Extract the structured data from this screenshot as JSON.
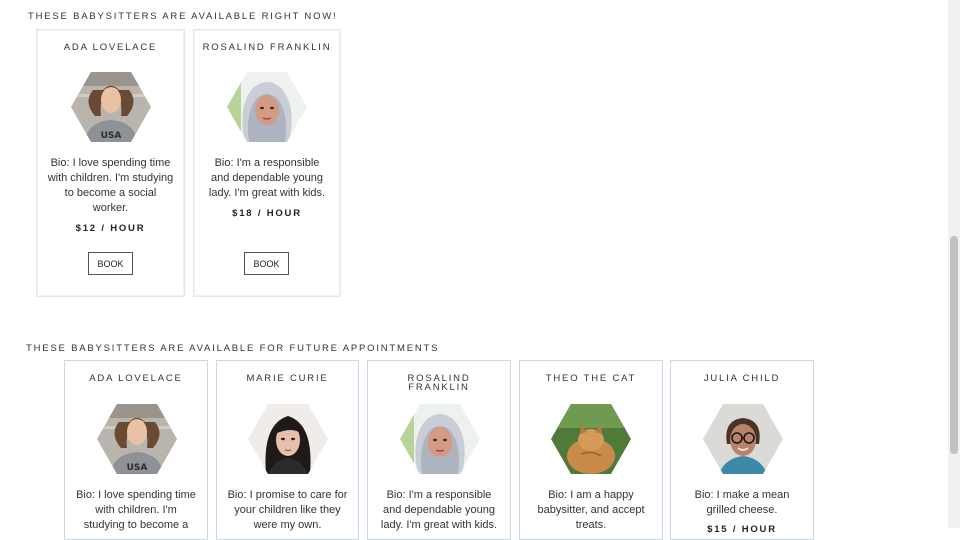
{
  "sections": {
    "now_title": "THESE BABYSITTERS ARE AVAILABLE RIGHT NOW!",
    "future_title": "THESE BABYSITTERS ARE AVAILABLE FOR FUTURE APPOINTMENTS"
  },
  "available_now": [
    {
      "name": "ADA LOVELACE",
      "bio": "Bio: I love spending time with children. I'm studying to become a social worker.",
      "rate": "$12 / HOUR",
      "button": "BOOK"
    },
    {
      "name": "ROSALIND FRANKLIN",
      "bio": "Bio: I'm a responsible and dependable young lady. I'm great with kids.",
      "rate": "$18 / HOUR",
      "button": "BOOK"
    }
  ],
  "future": [
    {
      "name": "ADA LOVELACE",
      "bio": "Bio: I love spending time with children. I'm studying to become a"
    },
    {
      "name": "MARIE CURIE",
      "bio": "Bio: I promise to care for your children like they were my own."
    },
    {
      "name": "ROSALIND FRANKLIN",
      "bio": "Bio: I'm a responsible and dependable young lady. I'm great with kids."
    },
    {
      "name": "THEO THE CAT",
      "bio": "Bio: I am a happy babysitter, and accept treats."
    },
    {
      "name": "JULIA CHILD",
      "bio": "Bio: I make a mean grilled cheese.",
      "rate": "$15 / HOUR"
    }
  ]
}
